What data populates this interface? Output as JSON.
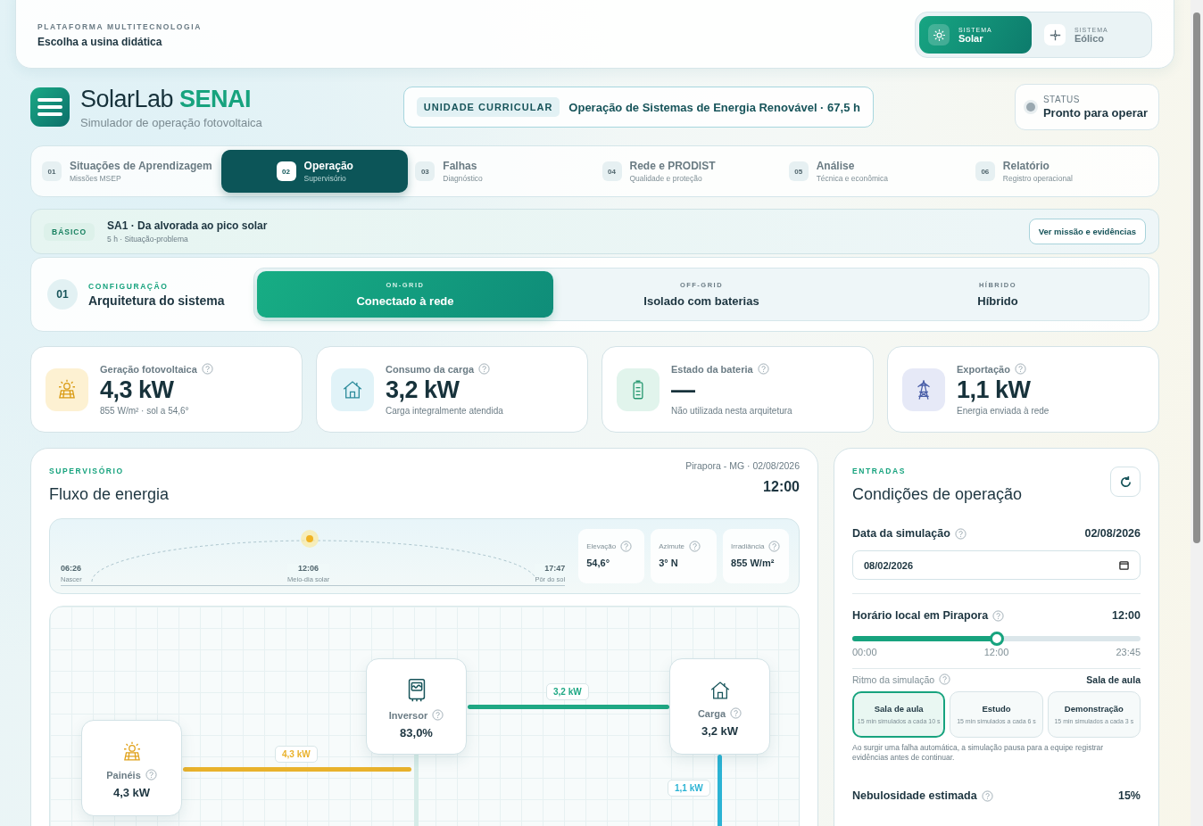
{
  "platform": {
    "eyebrow": "PLATAFORMA MULTITECNOLOGIA",
    "title": "Escolha a usina didática",
    "systems": [
      {
        "kind": "solar",
        "eyebrow": "SISTEMA",
        "label": "Solar",
        "selected": true
      },
      {
        "kind": "wind",
        "eyebrow": "SISTEMA",
        "label": "Eólico",
        "selected": false
      }
    ]
  },
  "brand": {
    "name": "SolarLab",
    "accent": "SENAI",
    "subtitle": "Simulador de operação fotovoltaica"
  },
  "curricular_unit": {
    "tag": "UNIDADE CURRICULAR",
    "text": "Operação de Sistemas de Energia Renovável · 67,5 h"
  },
  "status": {
    "label": "STATUS",
    "text": "Pronto para operar"
  },
  "steps": [
    {
      "number": "01",
      "title": "Situações de Aprendizagem",
      "subtitle": "Missões MSEP",
      "selected": false
    },
    {
      "number": "02",
      "title": "Operação",
      "subtitle": "Supervisório",
      "selected": true
    },
    {
      "number": "03",
      "title": "Falhas",
      "subtitle": "Diagnóstico",
      "selected": false
    },
    {
      "number": "04",
      "title": "Rede e PRODIST",
      "subtitle": "Qualidade e proteção",
      "selected": false
    },
    {
      "number": "05",
      "title": "Análise",
      "subtitle": "Técnica e econômica",
      "selected": false
    },
    {
      "number": "06",
      "title": "Relatório",
      "subtitle": "Registro operacional",
      "selected": false
    }
  ],
  "mission": {
    "badge": "BÁSICO",
    "title": "SA1 · Da alvorada ao pico solar",
    "meta": "5 h · Situação-problema",
    "button": "Ver missão e evidências"
  },
  "configuration": {
    "number": "01",
    "eyebrow": "CONFIGURAÇÃO",
    "title": "Arquitetura do sistema",
    "options": [
      {
        "eyebrow": "ON-GRID",
        "label": "Conectado à rede",
        "selected": true
      },
      {
        "eyebrow": "OFF-GRID",
        "label": "Isolado com baterias",
        "selected": false
      },
      {
        "eyebrow": "HÍBRIDO",
        "label": "Híbrido",
        "selected": false
      }
    ]
  },
  "metrics": [
    {
      "kind": "solar",
      "label": "Geração fotovoltaica",
      "value": "4,3 kW",
      "note": "855 W/m² · sol a 54,6°"
    },
    {
      "kind": "load",
      "label": "Consumo da carga",
      "value": "3,2 kW",
      "note": "Carga integralmente atendida"
    },
    {
      "kind": "battery",
      "label": "Estado da bateria",
      "value": "—",
      "note": "Não utilizada nesta arquitetura"
    },
    {
      "kind": "grid",
      "label": "Exportação",
      "value": "1,1 kW",
      "note": "Energia enviada à rede"
    }
  ],
  "supervisor": {
    "eyebrow": "SUPERVISÓRIO",
    "title": "Fluxo de energia",
    "location": "Pirapora - MG · 02/08/2026",
    "time": "12:00",
    "sun_path": {
      "level": 0.49,
      "marks": [
        {
          "time": "06:26",
          "label": "Nascer"
        },
        {
          "time": "12:06",
          "label": "Meio-dia solar"
        },
        {
          "time": "17:47",
          "label": "Pôr do sol"
        }
      ]
    },
    "sun_stats": [
      {
        "label": "Elevação",
        "value": "54,6°"
      },
      {
        "label": "Azimute",
        "value": "3° N"
      },
      {
        "label": "Irradiância",
        "value": "855 W/m²"
      }
    ],
    "nodes": [
      {
        "kind": "panels",
        "label": "Painéis",
        "value": "4,3 kW"
      },
      {
        "kind": "inverter",
        "label": "Inversor",
        "value": "83,0%"
      },
      {
        "kind": "load",
        "label": "Carga",
        "value": "3,2 kW"
      }
    ],
    "flows": [
      {
        "label": "4,3 kW",
        "color": "#e9b22c"
      },
      {
        "label": "3,2 kW",
        "color": "#1fa884"
      },
      {
        "label": "1,1 kW",
        "color": "#2bb3d4"
      }
    ]
  },
  "inputs": {
    "eyebrow": "ENTRADAS",
    "title": "Condições de operação",
    "date": {
      "label": "Data da simulação",
      "display": "02/08/2026",
      "value": "08/02/2026"
    },
    "time": {
      "label": "Horário local em Pirapora",
      "display": "12:00",
      "level": 0.5,
      "ticks": [
        "00:00",
        "12:00",
        "23:45"
      ]
    },
    "pace": {
      "label": "Ritmo da simulação",
      "display": "Sala de aula",
      "options": [
        {
          "label": "Sala de aula",
          "note": "15 min simulados a cada 10 s",
          "selected": true
        },
        {
          "label": "Estudo",
          "note": "15 min simulados a cada 6 s",
          "selected": false
        },
        {
          "label": "Demonstração",
          "note": "15 min simulados a cada 3 s",
          "selected": false
        }
      ],
      "note": "Ao surgir uma falha automática, a simulação pausa para a equipe registrar evidências antes de continuar."
    },
    "cloudiness": {
      "label": "Nebulosidade estimada",
      "display": "15%"
    }
  }
}
